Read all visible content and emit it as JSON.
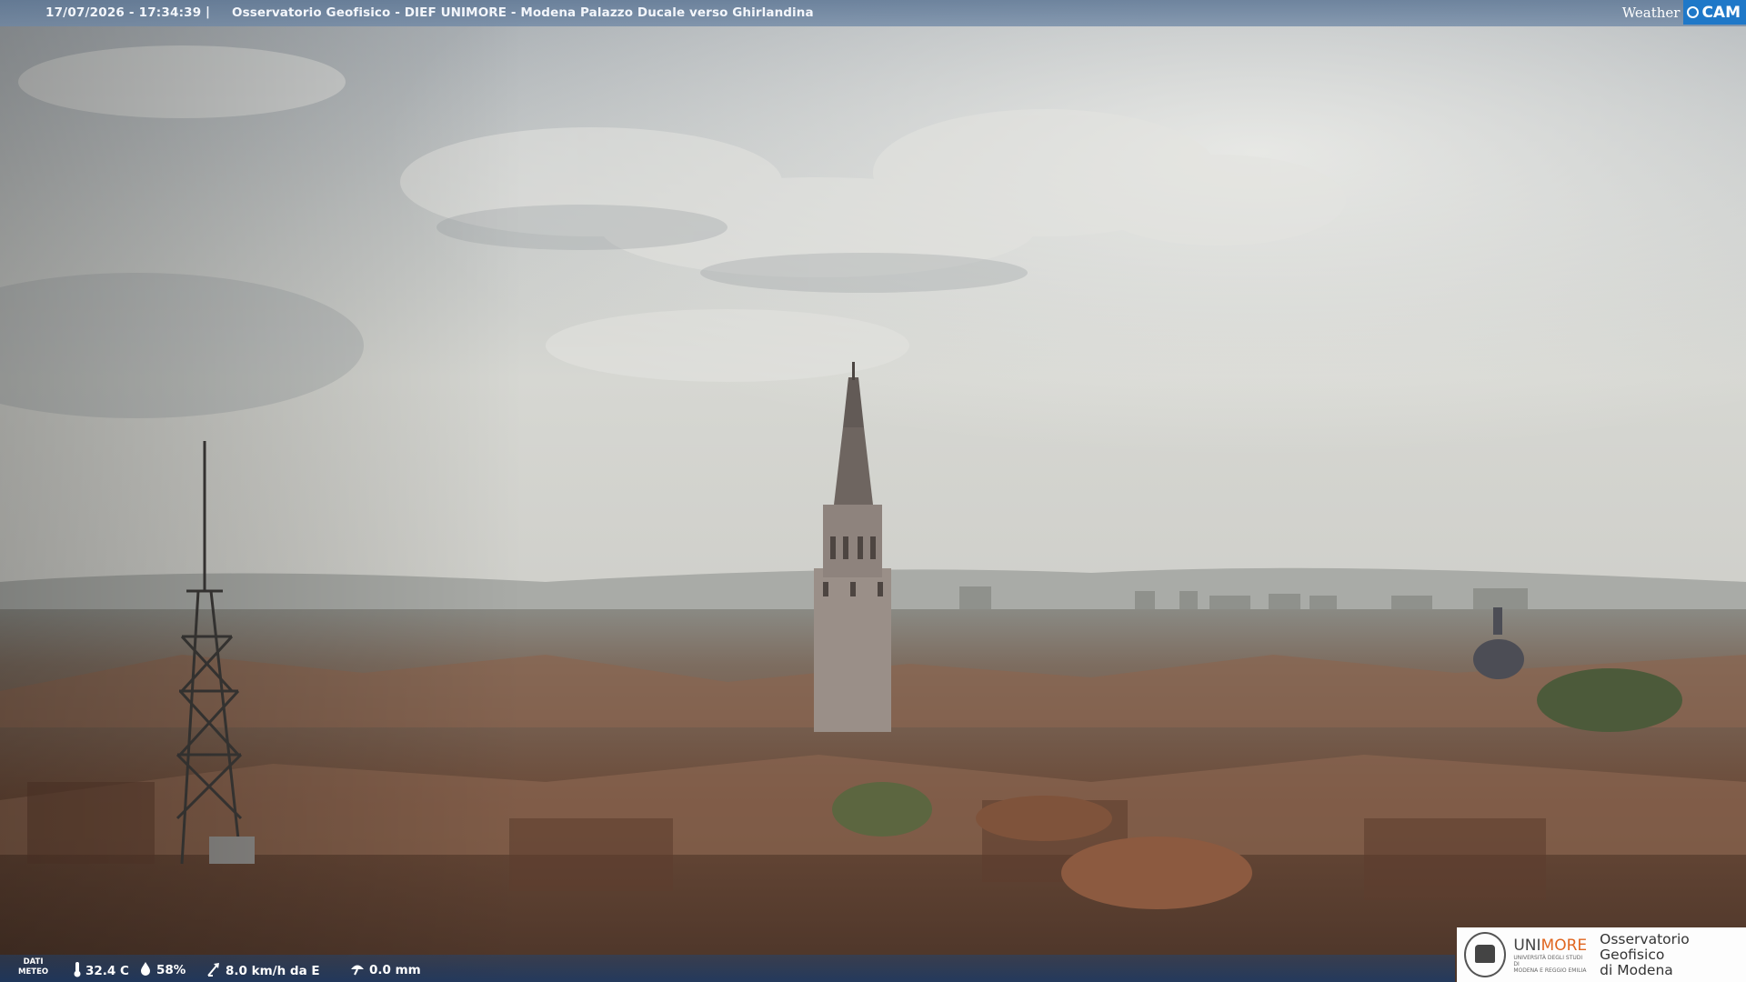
{
  "overlay": {
    "timestamp": "17/07/2026 - 17:34:39",
    "separator": "|",
    "title": "Osservatorio Geofisico - DIEF UNIMORE - Modena Palazzo Ducale verso Ghirlandina",
    "brand_weather": "Weather",
    "brand_cam": "CAM"
  },
  "meteo": {
    "label_line1": "DATI",
    "label_line2": "METEO",
    "temperature": "32.4 C",
    "humidity": "58%",
    "wind": "8.0 km/h da E",
    "rain": "0.0 mm",
    "icons": [
      "thermometer-icon",
      "humidity-drop-icon",
      "wind-vane-icon",
      "rain-gauge-icon"
    ]
  },
  "logo": {
    "uni_prefix": "UNI",
    "uni_suffix": "MORE",
    "uni_sub1": "UNIVERSITÀ DEGLI STUDI DI",
    "uni_sub2": "MODENA E REGGIO EMILIA",
    "obs_line1": "Osservatorio Geofisico",
    "obs_line2": "di Modena"
  },
  "colors": {
    "sky": "#c9ccca",
    "roofs": "#7a5a45",
    "accent": "#1f78c8",
    "uni_orange": "#e06620"
  }
}
